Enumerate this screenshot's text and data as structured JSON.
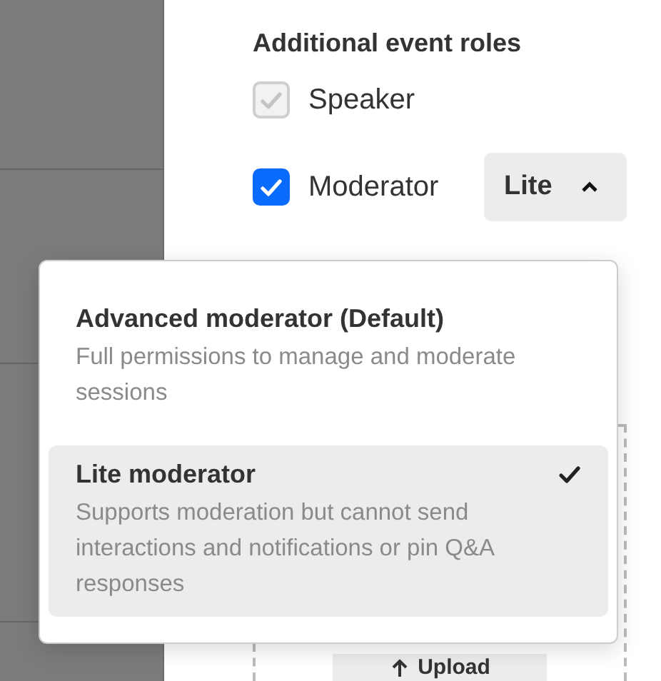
{
  "section": {
    "title": "Additional event roles"
  },
  "roles": [
    {
      "label": "Speaker",
      "checked": true,
      "disabled": true
    },
    {
      "label": "Moderator",
      "checked": true,
      "disabled": false
    }
  ],
  "level_select": {
    "value": "Lite",
    "expanded": true
  },
  "menu": [
    {
      "title": "Advanced moderator (Default)",
      "description": "Full permissions to manage and moderate sessions",
      "selected": false
    },
    {
      "title": "Lite moderator",
      "description": "Supports moderation but cannot send interactions and notifications or pin Q&A responses",
      "selected": true
    }
  ],
  "upload": {
    "label": "Upload"
  }
}
